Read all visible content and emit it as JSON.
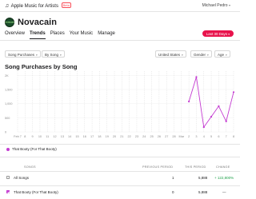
{
  "header": {
    "brand": "Apple Music for Artists",
    "beta_label": "Beta",
    "user": "Michael Pedro"
  },
  "artist": {
    "name": "Novacain",
    "avatar_text": "NOVACAIN"
  },
  "nav": {
    "tabs": [
      "Overview",
      "Trends",
      "Places",
      "Your Music",
      "Manage"
    ],
    "active": "Trends"
  },
  "range_button": "Last 30 Days",
  "filters": {
    "metric": "Song Purchases",
    "breakdown": "By Song",
    "country": "United States",
    "gender": "Gender",
    "age": "Age"
  },
  "chart_data": {
    "type": "line",
    "title": "Song Purchases by Song",
    "x": [
      "Feb 7",
      "8",
      "9",
      "10",
      "11",
      "12",
      "13",
      "14",
      "15",
      "16",
      "17",
      "18",
      "19",
      "20",
      "21",
      "22",
      "23",
      "24",
      "25",
      "26",
      "27",
      "28",
      "Mar",
      "2",
      "3",
      "4",
      "5",
      "6",
      "7",
      "8"
    ],
    "series": [
      {
        "name": "That Booty (For That Booty)",
        "color": "#c43bd1",
        "values": [
          null,
          null,
          null,
          null,
          null,
          null,
          null,
          null,
          null,
          null,
          null,
          null,
          null,
          null,
          null,
          null,
          null,
          null,
          null,
          null,
          null,
          null,
          null,
          1.3,
          2.35,
          0.2,
          0.65,
          1.1,
          0.45,
          1.7
        ]
      }
    ],
    "y_ticks": [
      "0",
      "500",
      "1,000",
      "1,500",
      "2K"
    ],
    "ylim": [
      0,
      2.6
    ],
    "grid": true
  },
  "legend": {
    "label": "That Booty (For That Booty)"
  },
  "table": {
    "headers": [
      "SONGS",
      "PREVIOUS PERIOD",
      "THIS PERIOD",
      "CHANGE"
    ],
    "rows": [
      {
        "song": "All Songs",
        "previous": "1",
        "current": "5,888",
        "change": "+ 122,800%",
        "checked": false
      },
      {
        "song": "That Booty (For That Booty)",
        "previous": "0",
        "current": "5,888",
        "change": "—",
        "checked": true
      }
    ]
  }
}
